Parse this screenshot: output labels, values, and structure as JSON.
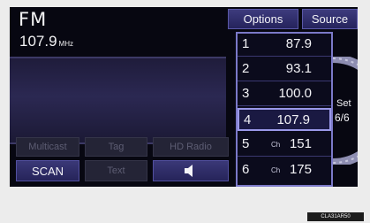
{
  "radio": {
    "band": "FM",
    "frequency": "107.9",
    "unit": "MHz"
  },
  "top_buttons": {
    "options": "Options",
    "source": "Source"
  },
  "bottom_buttons": {
    "multicast": "Multicast",
    "tag": "Tag",
    "hd_radio": "HD Radio",
    "scan": "SCAN",
    "text": "Text",
    "volume_icon": "speaker-icon"
  },
  "presets": [
    {
      "number": "1",
      "channel_prefix": "",
      "value": "87.9"
    },
    {
      "number": "2",
      "channel_prefix": "",
      "value": "93.1"
    },
    {
      "number": "3",
      "channel_prefix": "",
      "value": "100.0"
    },
    {
      "number": "4",
      "channel_prefix": "",
      "value": "107.9",
      "selected": true
    },
    {
      "number": "5",
      "channel_prefix": "Ch",
      "value": "151"
    },
    {
      "number": "6",
      "channel_prefix": "Ch",
      "value": "175"
    }
  ],
  "set": {
    "label": "Set",
    "count": "6/6"
  },
  "image_code": "CLA31AR50",
  "colors": {
    "accent": "#7b79c8",
    "button": "#2f2d6b",
    "background": "#070711"
  }
}
